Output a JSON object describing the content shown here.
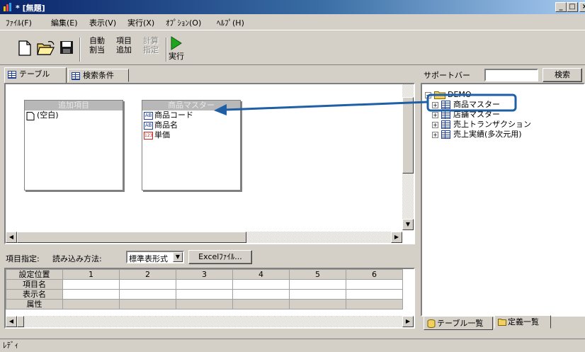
{
  "window": {
    "title": "* [無題]",
    "controls": [
      "_",
      "□",
      "×"
    ]
  },
  "menu": [
    "ﾌｧｲﾙ(F)",
    "編集(E)",
    "表示(V)",
    "実行(X)",
    "ｵﾌﾟｼｮﾝ(O)",
    "ﾍﾙﾌﾟ(H)"
  ],
  "toolbar": {
    "auto_assign": "自動\n割当",
    "add_item": "項目\n追加",
    "calc_spec": "計算\n指定",
    "run": "実行"
  },
  "tabs": {
    "table": "テーブル",
    "search": "検索条件"
  },
  "diagram": {
    "added_items": {
      "header": "追加項目",
      "rows": [
        "(空白)"
      ]
    },
    "product_master": {
      "header": "商品マスター",
      "rows": [
        {
          "icon": "text-field-icon",
          "icon_text": "AB",
          "label": "商品コード"
        },
        {
          "icon": "text-field-icon",
          "icon_text": "AB",
          "label": "商品名"
        },
        {
          "icon": "numeric-field-icon",
          "icon_text": "123",
          "label": "単価"
        }
      ]
    }
  },
  "spec": {
    "label": "項目指定:",
    "method_label": "読み込み方法:",
    "method_value": "標準表形式",
    "excel_button": "Excelﾌｧｲﾙ..."
  },
  "grid": {
    "row_headers": [
      "設定位置",
      "項目名",
      "表示名",
      "属性"
    ],
    "columns": [
      "1",
      "2",
      "3",
      "4",
      "5",
      "6"
    ]
  },
  "support": {
    "label": "サポートバー",
    "search_value": "",
    "search_button": "検索",
    "root": "DEMO",
    "items": [
      "商品マスター",
      "店舗マスター",
      "売上トランザクション",
      "売上実績(多次元用)"
    ],
    "tab_tables": "テーブル一覧",
    "tab_defs": "定義一覧"
  },
  "status": "ﾚﾃﾞｨ",
  "colors": {
    "titlebar_start": "#0a246a",
    "highlight": "#1f5fa6",
    "run_green": "#1ea51e"
  }
}
